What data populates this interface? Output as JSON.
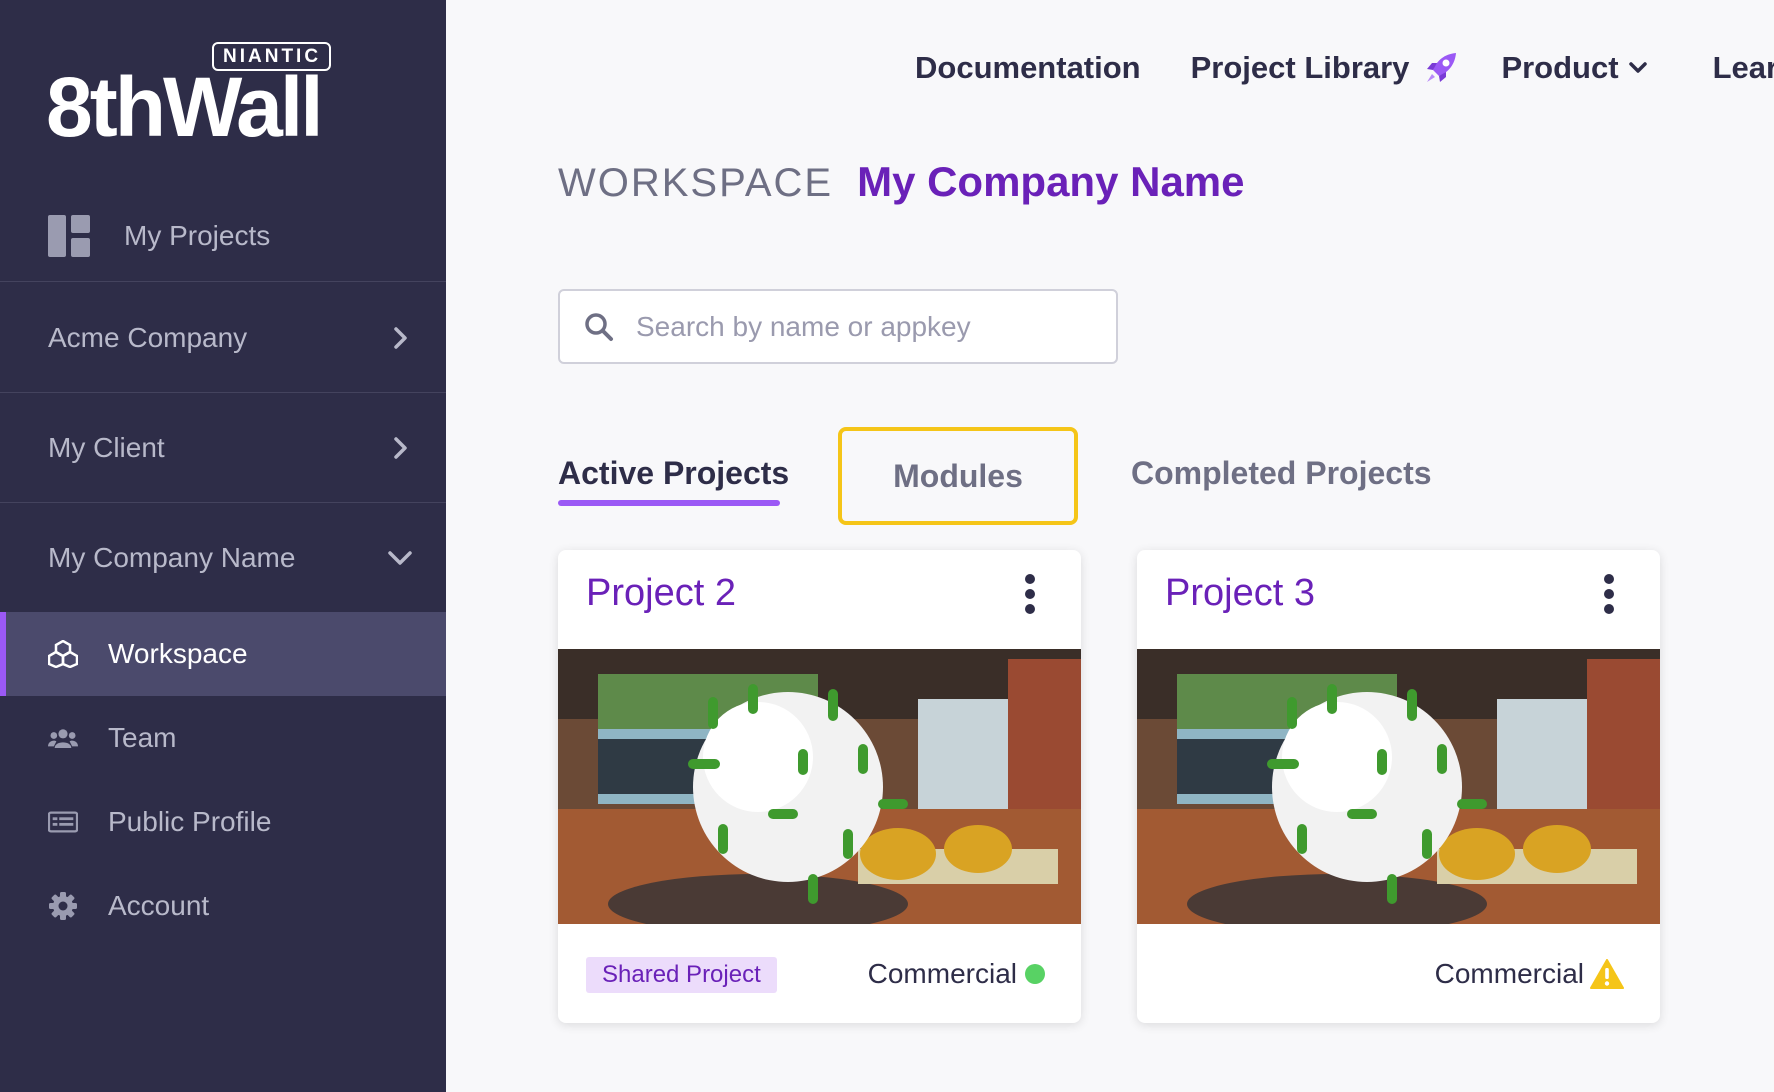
{
  "brand": {
    "niantic": "NIANTIC",
    "name": "8thWall"
  },
  "sidebar": {
    "my_projects": {
      "label": "My Projects",
      "icon": "dashboard-icon"
    },
    "groups": [
      {
        "label": "Acme Company",
        "expanded": false
      },
      {
        "label": "My Client",
        "expanded": false
      },
      {
        "label": "My Company Name",
        "expanded": true
      }
    ],
    "items": [
      {
        "label": "Workspace",
        "icon": "cubes-icon",
        "active": true
      },
      {
        "label": "Team",
        "icon": "users-icon",
        "active": false
      },
      {
        "label": "Public Profile",
        "icon": "profile-card-icon",
        "active": false
      },
      {
        "label": "Account",
        "icon": "gear-icon",
        "active": false
      }
    ]
  },
  "topnav": {
    "documentation": "Documentation",
    "project_library": "Project Library",
    "product": "Product",
    "learn": "Learn"
  },
  "heading": {
    "prefix": "WORKSPACE",
    "company": "My Company Name"
  },
  "search": {
    "placeholder": "Search by name or appkey",
    "value": ""
  },
  "tabs": [
    {
      "label": "Active Projects",
      "active": true
    },
    {
      "label": "Modules",
      "active": false,
      "highlighted": true
    },
    {
      "label": "Completed Projects",
      "active": false
    }
  ],
  "projects": [
    {
      "title": "Project 2",
      "badge": "Shared Project",
      "status": "Commercial",
      "status_indicator": "green-dot"
    },
    {
      "title": "Project 3",
      "badge": "",
      "status": "Commercial",
      "status_indicator": "warning-icon"
    }
  ],
  "colors": {
    "sidebar_bg": "#2e2d48",
    "accent_purple": "#6a21b8",
    "active_bar": "#9b59f5",
    "highlight_yellow": "#f5c518",
    "status_green": "#58d264",
    "warning_yellow": "#f5c518"
  }
}
